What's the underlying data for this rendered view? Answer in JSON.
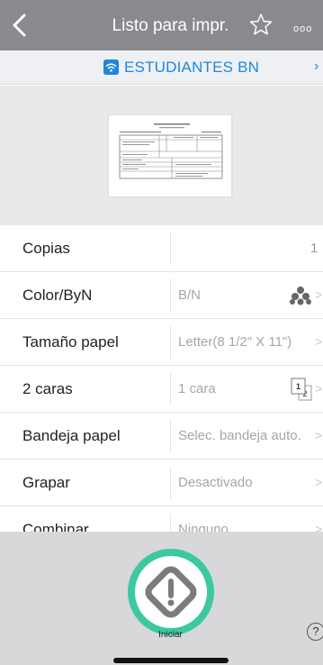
{
  "header": {
    "title": "Listo para impr.",
    "more_label": "ooo"
  },
  "printer": {
    "network_name": "ESTUDIANTES BN",
    "chevron": "›"
  },
  "settings": [
    {
      "label": "Copias",
      "value": "",
      "count": "1"
    },
    {
      "label": "Color/ByN",
      "value": "B/N"
    },
    {
      "label": "Tamaño papel",
      "value": "Letter(8 1/2\" X 11\")"
    },
    {
      "label": "2 caras",
      "value": "1 cara"
    },
    {
      "label": "Bandeja papel",
      "value": "Selec. bandeja auto."
    },
    {
      "label": "Grapar",
      "value": "Desactivado"
    },
    {
      "label": "Combinar",
      "value": "Ninguno"
    }
  ],
  "bottom": {
    "start_label": "Iniciar",
    "help_label": "?"
  },
  "colors": {
    "header_bg": "#888a8d",
    "accent_blue": "#1f86dd",
    "start_green": "#3cc9a2"
  },
  "icons": {
    "back": "chevron-left-icon",
    "favorite": "star-outline-icon",
    "wifi": "wifi-icon",
    "color_mode": "color-dots-icon",
    "duplex": "duplex-pages-icon",
    "start": "diamond-start-icon"
  }
}
